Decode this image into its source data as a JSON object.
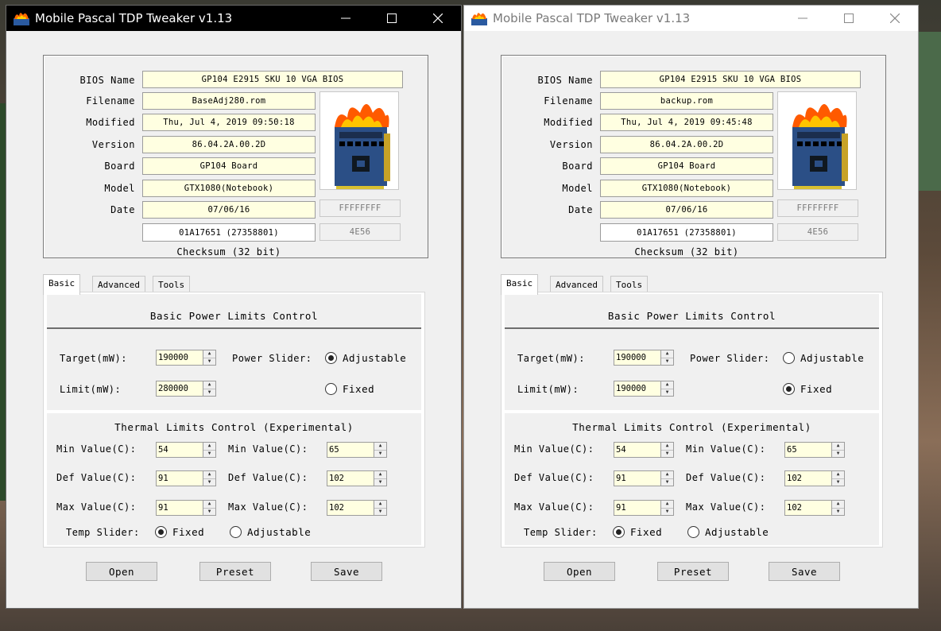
{
  "windows": [
    {
      "title": "Mobile Pascal TDP Tweaker v1.13",
      "info": {
        "bios_name_label": "BIOS Name",
        "bios_name": "GP104 E2915 SKU 10 VGA BIOS",
        "filename_label": "Filename",
        "filename": "BaseAdj280.rom",
        "modified_label": "Modified",
        "modified": "Thu, Jul 4, 2019 09:50:18",
        "version_label": "Version",
        "version": "86.04.2A.00.2D",
        "board_label": "Board",
        "board": "GP104 Board",
        "model_label": "Model",
        "model": "GTX1080(Notebook)",
        "date_label": "Date",
        "date": "07/06/16",
        "hex_field": "FFFFFFFF",
        "checksum_value": "01A17651 (27358801)",
        "checksum_short": "4E56",
        "checksum_label": "Checksum (32 bit)"
      },
      "tabs": [
        "Basic",
        "Advanced",
        "Tools"
      ],
      "power": {
        "title": "Basic Power Limits Control",
        "target_label": "Target(mW):",
        "target": "190000",
        "limit_label": "Limit(mW):",
        "limit": "280000",
        "slider_label": "Power Slider:",
        "adjustable_label": "Adjustable",
        "fixed_label": "Fixed",
        "selected": "adjustable"
      },
      "thermal": {
        "title": "Thermal Limits Control (Experimental)",
        "min_label": "Min Value(C):",
        "def_label": "Def Value(C):",
        "max_label": "Max Value(C):",
        "min1": "54",
        "def1": "91",
        "max1": "91",
        "min2": "65",
        "def2": "102",
        "max2": "102",
        "slider_label": "Temp Slider:",
        "fixed_label": "Fixed",
        "adjustable_label": "Adjustable",
        "selected": "fixed"
      },
      "buttons": {
        "open": "Open",
        "preset": "Preset",
        "save": "Save"
      }
    },
    {
      "title": "Mobile Pascal TDP Tweaker v1.13",
      "info": {
        "bios_name_label": "BIOS Name",
        "bios_name": "GP104 E2915 SKU 10 VGA BIOS",
        "filename_label": "Filename",
        "filename": "backup.rom",
        "modified_label": "Modified",
        "modified": "Thu, Jul 4, 2019 09:45:48",
        "version_label": "Version",
        "version": "86.04.2A.00.2D",
        "board_label": "Board",
        "board": "GP104 Board",
        "model_label": "Model",
        "model": "GTX1080(Notebook)",
        "date_label": "Date",
        "date": "07/06/16",
        "hex_field": "FFFFFFFF",
        "checksum_value": "01A17651 (27358801)",
        "checksum_short": "4E56",
        "checksum_label": "Checksum (32 bit)"
      },
      "tabs": [
        "Basic",
        "Advanced",
        "Tools"
      ],
      "power": {
        "title": "Basic Power Limits Control",
        "target_label": "Target(mW):",
        "target": "190000",
        "limit_label": "Limit(mW):",
        "limit": "190000",
        "slider_label": "Power Slider:",
        "adjustable_label": "Adjustable",
        "fixed_label": "Fixed",
        "selected": "fixed"
      },
      "thermal": {
        "title": "Thermal Limits Control (Experimental)",
        "min_label": "Min Value(C):",
        "def_label": "Def Value(C):",
        "max_label": "Max Value(C):",
        "min1": "54",
        "def1": "91",
        "max1": "91",
        "min2": "65",
        "def2": "102",
        "max2": "102",
        "slider_label": "Temp Slider:",
        "fixed_label": "Fixed",
        "adjustable_label": "Adjustable",
        "selected": "fixed"
      },
      "buttons": {
        "open": "Open",
        "preset": "Preset",
        "save": "Save"
      }
    }
  ]
}
